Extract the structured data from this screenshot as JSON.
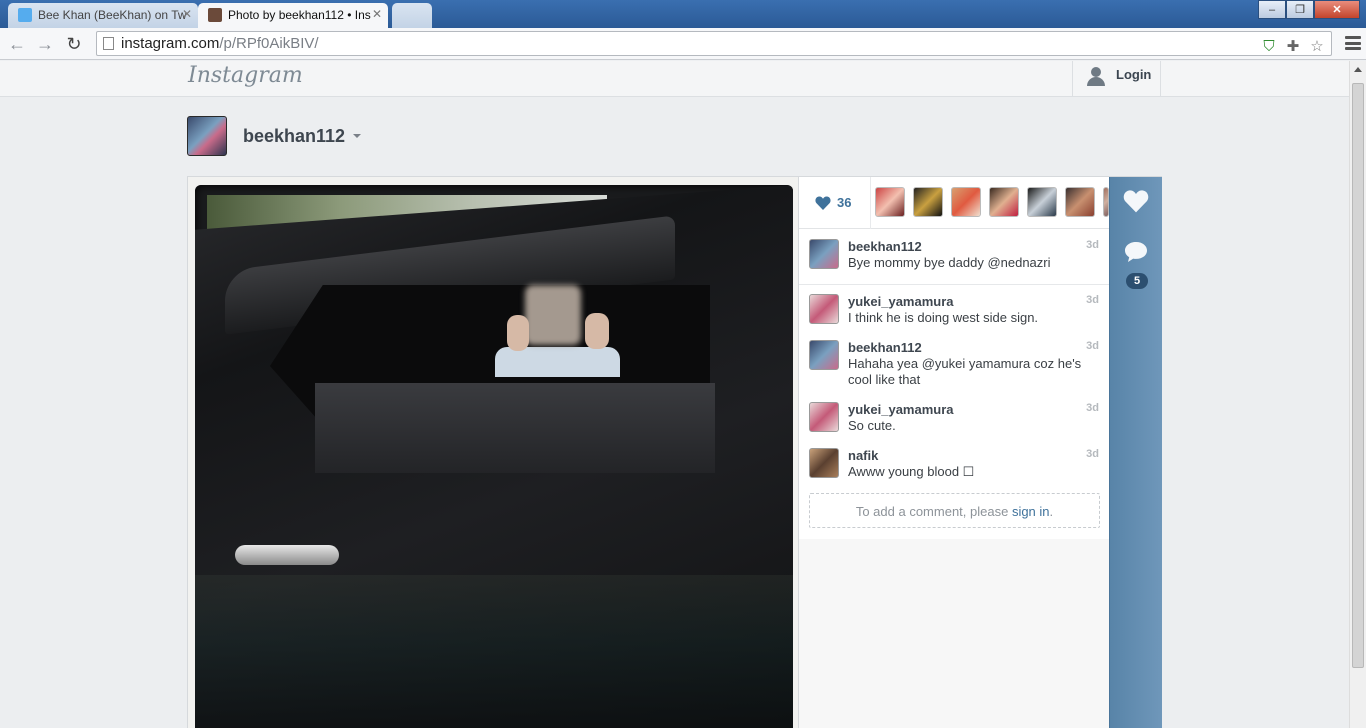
{
  "browser": {
    "tabs": [
      {
        "title": "Bee Khan (BeeKhan) on Tw",
        "active": false
      },
      {
        "title": "Photo by beekhan112 • Ins",
        "active": true
      },
      {
        "title": "",
        "active": false
      }
    ],
    "url_domain": "instagram.com",
    "url_path": "/p/RPf0AikBIV/",
    "window_buttons": {
      "minimize": "–",
      "maximize": "❐",
      "close": "✕"
    }
  },
  "header": {
    "logo": "Instagram",
    "login_label": "Login"
  },
  "post": {
    "owner": "beekhan112",
    "likes_count": "36",
    "likers_count": 7,
    "comment_count": "5"
  },
  "comments": [
    {
      "user": "beekhan112",
      "time": "3d",
      "text": "Bye mommy bye daddy @nednazri"
    },
    {
      "user": "yukei_yamamura",
      "time": "3d",
      "text": "I think he is doing west side sign."
    },
    {
      "user": "beekhan112",
      "time": "3d",
      "text": "Hahaha yea @yukei  yamamura coz he's cool like that"
    },
    {
      "user": "yukei_yamamura",
      "time": "3d",
      "text": "So cute."
    },
    {
      "user": "nafik",
      "time": "3d",
      "text": "Awww young blood ☐"
    }
  ],
  "add_comment": {
    "prefix": "To add a comment, please ",
    "link": "sign in",
    "suffix": "."
  },
  "colors": {
    "accent": "#3f729b",
    "action_bar": "#5884a8",
    "text": "#3f4750"
  }
}
